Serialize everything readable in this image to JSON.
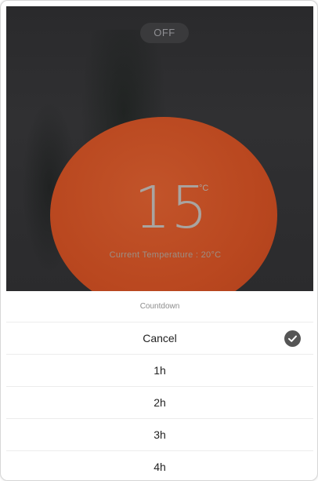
{
  "power": {
    "label": "OFF"
  },
  "thermostat": {
    "target_value": "15",
    "unit": "°C",
    "current_label": "Current Temperature : 20°C"
  },
  "countdown_sheet": {
    "title": "Countdown",
    "options": [
      {
        "label": "Cancel",
        "selected": true
      },
      {
        "label": "1h",
        "selected": false
      },
      {
        "label": "2h",
        "selected": false
      },
      {
        "label": "3h",
        "selected": false
      },
      {
        "label": "4h",
        "selected": false
      }
    ],
    "selected_icon": "check-circle-icon"
  },
  "colors": {
    "dial": "#bd4a21",
    "overlay": "#2c2c2e",
    "check": "#555555"
  }
}
